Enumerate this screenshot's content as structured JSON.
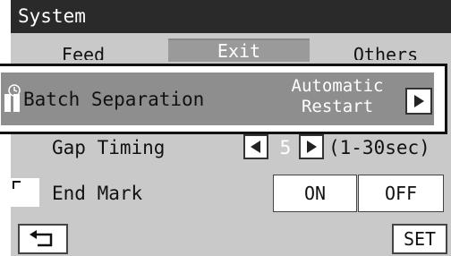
{
  "title": "System",
  "tabs": [
    {
      "label": "Feed",
      "active": false
    },
    {
      "label": "Exit",
      "active": true
    },
    {
      "label": "Others",
      "active": false
    }
  ],
  "batch": {
    "label": "Batch Separation",
    "value": "Automatic Restart",
    "icon": "batch-clock-icon",
    "right_icon": "triangle-right-icon"
  },
  "gap": {
    "label": "Gap Timing",
    "value": "5",
    "range": "(1-30sec)",
    "left_icon": "triangle-left-icon",
    "right_icon": "triangle-right-icon"
  },
  "end_mark": {
    "label": "End Mark",
    "icon": "end-mark-icon",
    "options": [
      "ON",
      "OFF"
    ]
  },
  "footer": {
    "back_icon": "back-arrow-icon",
    "set_label": "SET"
  },
  "colors": {
    "background": "#c9c9c9",
    "titlebar": "#2a2a2a",
    "highlight": "#8e8e8e",
    "active_tab": "#9a9a9a"
  }
}
